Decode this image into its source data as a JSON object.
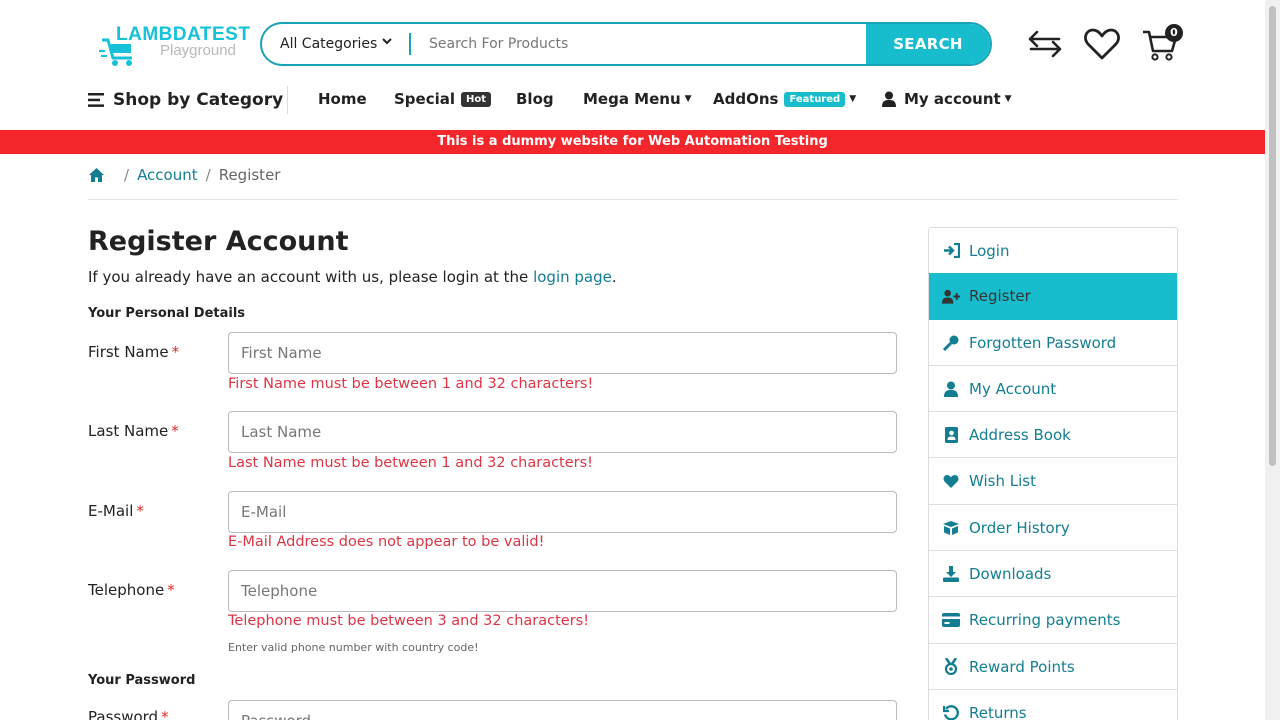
{
  "header": {
    "logo": {
      "brand": "LAMBDATEST",
      "sub": "Playground"
    },
    "search": {
      "category": "All Categories",
      "placeholder": "Search For Products",
      "button": "SEARCH"
    },
    "cart_count": "0",
    "icons": [
      "compare-icon",
      "heart-icon",
      "cart-icon"
    ]
  },
  "nav": {
    "shop_by_category": "Shop by Category",
    "home": "Home",
    "special": "Special",
    "special_tag": "Hot",
    "blog": "Blog",
    "mega_menu": "Mega Menu",
    "addons": "AddOns",
    "addons_tag": "Featured",
    "my_account": "My account"
  },
  "banner": "This is a dummy website for Web Automation Testing",
  "breadcrumb": {
    "account": "Account",
    "current": "Register"
  },
  "form": {
    "title": "Register Account",
    "intro_text": "If you already have an account with us, please login at the",
    "intro_link": "login page",
    "intro_end": ".",
    "personal_section": "Your Personal Details",
    "password_section": "Your Password",
    "fields": {
      "first_name": {
        "label": "First Name",
        "placeholder": "First Name",
        "error": "First Name must be between 1 and 32 characters!"
      },
      "last_name": {
        "label": "Last Name",
        "placeholder": "Last Name",
        "error": "Last Name must be between 1 and 32 characters!"
      },
      "email": {
        "label": "E-Mail",
        "placeholder": "E-Mail",
        "error": "E-Mail Address does not appear to be valid!"
      },
      "telephone": {
        "label": "Telephone",
        "placeholder": "Telephone",
        "error": "Telephone must be between 3 and 32 characters!",
        "help": "Enter valid phone number with country code!"
      },
      "password": {
        "label": "Password",
        "placeholder": "Password"
      }
    },
    "required_mark": "*"
  },
  "sidebar": {
    "items": [
      {
        "label": "Login",
        "icon": "sign-in-icon"
      },
      {
        "label": "Register",
        "icon": "user-plus-icon",
        "active": true
      },
      {
        "label": "Forgotten Password",
        "icon": "key-icon"
      },
      {
        "label": "My Account",
        "icon": "user-icon"
      },
      {
        "label": "Address Book",
        "icon": "address-book-icon"
      },
      {
        "label": "Wish List",
        "icon": "heart-icon"
      },
      {
        "label": "Order History",
        "icon": "box-open-icon"
      },
      {
        "label": "Downloads",
        "icon": "download-icon"
      },
      {
        "label": "Recurring payments",
        "icon": "credit-card-icon"
      },
      {
        "label": "Reward Points",
        "icon": "medal-icon"
      },
      {
        "label": "Returns",
        "icon": "undo-icon"
      }
    ]
  },
  "colors": {
    "accent": "#17bdcd",
    "link": "#137e91",
    "banner": "#f3262b",
    "error": "#dc3545"
  }
}
